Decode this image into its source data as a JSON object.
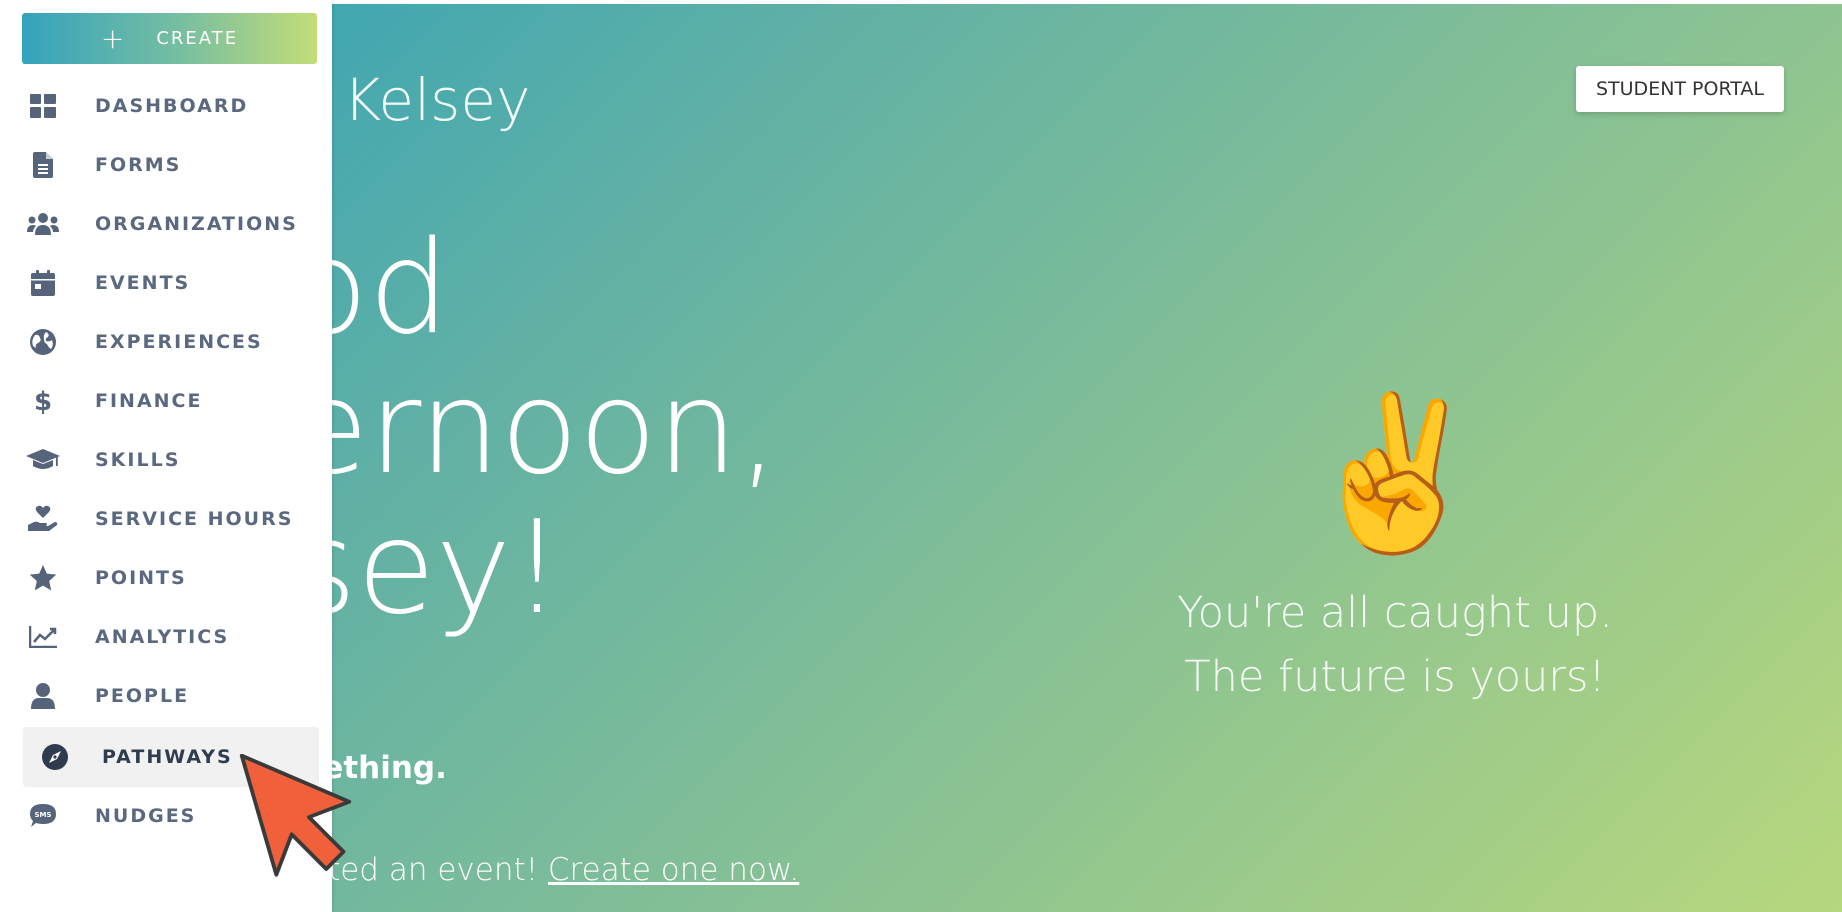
{
  "sidebar": {
    "create_label": "CREATE",
    "items": [
      {
        "label": "DASHBOARD",
        "icon": "dashboard-icon"
      },
      {
        "label": "FORMS",
        "icon": "document-icon"
      },
      {
        "label": "ORGANIZATIONS",
        "icon": "users-icon"
      },
      {
        "label": "EVENTS",
        "icon": "calendar-icon"
      },
      {
        "label": "EXPERIENCES",
        "icon": "globe-icon"
      },
      {
        "label": "FINANCE",
        "icon": "dollar-icon"
      },
      {
        "label": "SKILLS",
        "icon": "graduation-cap-icon"
      },
      {
        "label": "SERVICE HOURS",
        "icon": "hand-heart-icon"
      },
      {
        "label": "POINTS",
        "icon": "star-icon"
      },
      {
        "label": "ANALYTICS",
        "icon": "chart-line-icon"
      },
      {
        "label": "PEOPLE",
        "icon": "person-icon"
      },
      {
        "label": "PATHWAYS",
        "icon": "compass-icon",
        "active": true
      },
      {
        "label": "NUDGES",
        "icon": "sms-bubble-icon"
      }
    ]
  },
  "header": {
    "welcome": "g Kelsey",
    "portal_button": "STUDENT PORTAL"
  },
  "greeting": {
    "line1": "od",
    "line2": "ernoon,",
    "line3": "sey!"
  },
  "prompt": {
    "something": "mething.",
    "event_text": "eated an event! ",
    "event_link": "Create one now."
  },
  "status": {
    "emoji": "✌️",
    "line1": "You're all caught up.",
    "line2": "The future is yours!"
  },
  "colors": {
    "sidebar_text": "#5a6880",
    "gradient_start": "#2ea1b8",
    "gradient_end": "#b7d77d",
    "cursor": "#f0603a"
  }
}
